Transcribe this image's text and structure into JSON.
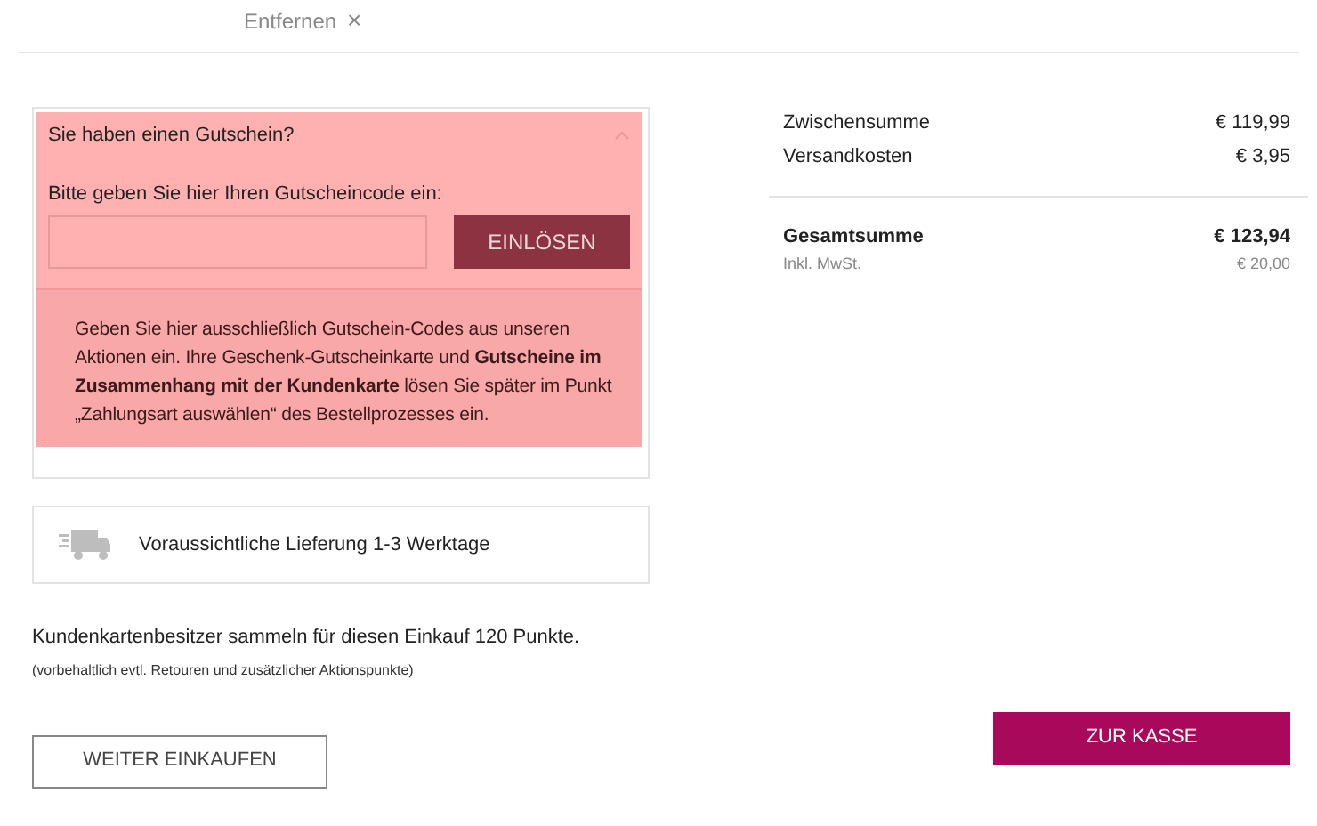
{
  "remove_link": {
    "label": "Entfernen",
    "icon": "×"
  },
  "voucher": {
    "title": "Sie haben einen Gutschein?",
    "expanded": true,
    "field_label": "Bitte geben Sie hier Ihren Gutscheincode ein:",
    "redeem_button": "EINLÖSEN",
    "notice": "Geben Sie hier ausschließlich Gutschein-Codes aus unseren Aktionen ein. Ihre Geschenk-Gutscheinkarte und **Gutscheine im Zusammenhang mit der Kundenkarte** lösen Sie später im Punkt „Zahlungsart auswählen“ des Bestellprozesses ein."
  },
  "delivery": {
    "text": "Voraussichtliche Lieferung 1-3 Werktage"
  },
  "points": {
    "text": "Kundenkartenbesitzer sammeln für diesen Einkauf 120 Punkte.",
    "note": "(vorbehaltlich evtl. Retouren und zusätzlicher Aktionspunkte)"
  },
  "summary": {
    "rows": [
      {
        "label": "Zwischensumme",
        "value": "€ 119,99"
      },
      {
        "label": "Versandkosten",
        "value": "€ 3,95"
      }
    ],
    "total": {
      "label": "Gesamtsumme",
      "value": "€ 123,94",
      "tax_label": "Inkl. MwSt.",
      "tax_value": "€ 20,00"
    }
  },
  "buttons": {
    "continue": "WEITER EINKAUFEN",
    "checkout": "ZUR KASSE"
  }
}
